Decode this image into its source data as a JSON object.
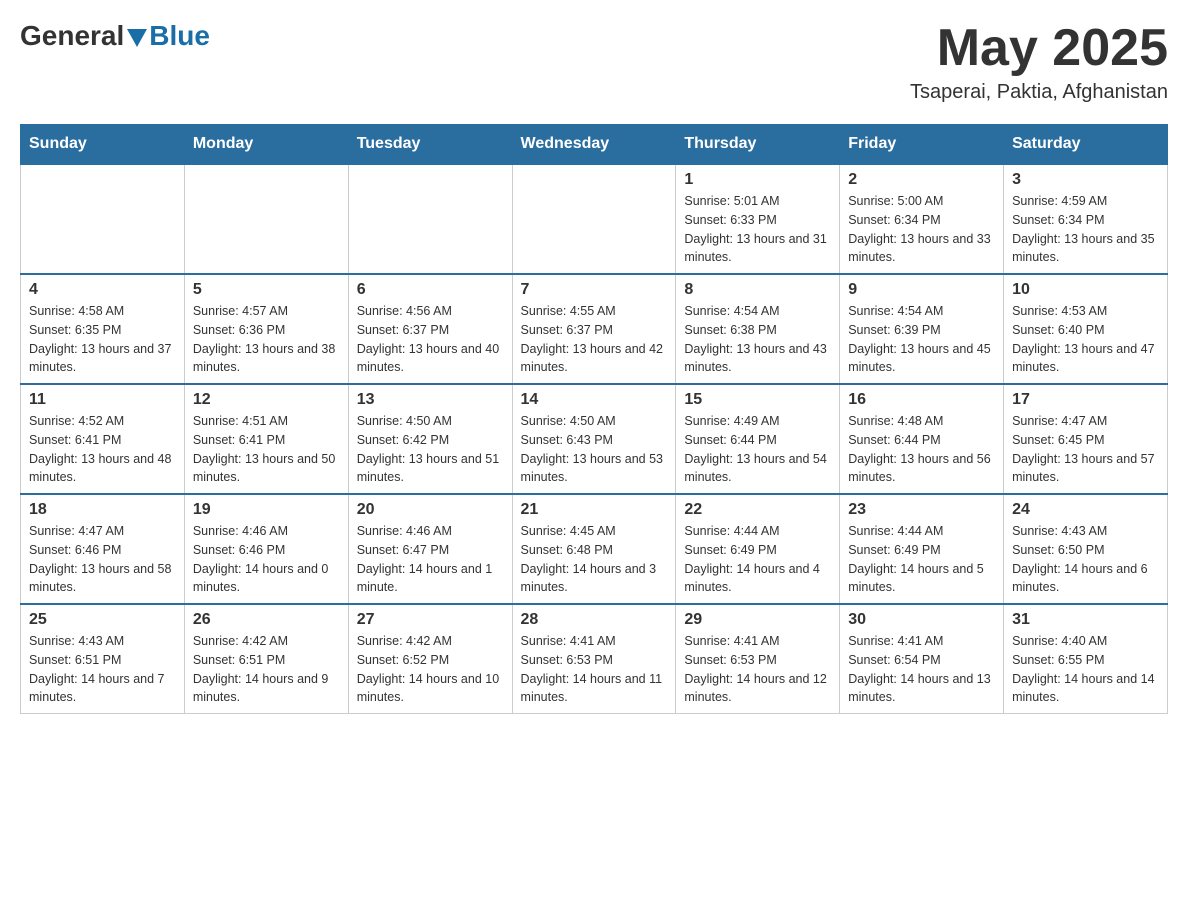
{
  "header": {
    "logo_general": "General",
    "logo_blue": "Blue",
    "month_year": "May 2025",
    "location": "Tsaperai, Paktia, Afghanistan"
  },
  "weekdays": [
    "Sunday",
    "Monday",
    "Tuesday",
    "Wednesday",
    "Thursday",
    "Friday",
    "Saturday"
  ],
  "weeks": [
    [
      {
        "day": "",
        "sunrise": "",
        "sunset": "",
        "daylight": ""
      },
      {
        "day": "",
        "sunrise": "",
        "sunset": "",
        "daylight": ""
      },
      {
        "day": "",
        "sunrise": "",
        "sunset": "",
        "daylight": ""
      },
      {
        "day": "",
        "sunrise": "",
        "sunset": "",
        "daylight": ""
      },
      {
        "day": "1",
        "sunrise": "Sunrise: 5:01 AM",
        "sunset": "Sunset: 6:33 PM",
        "daylight": "Daylight: 13 hours and 31 minutes."
      },
      {
        "day": "2",
        "sunrise": "Sunrise: 5:00 AM",
        "sunset": "Sunset: 6:34 PM",
        "daylight": "Daylight: 13 hours and 33 minutes."
      },
      {
        "day": "3",
        "sunrise": "Sunrise: 4:59 AM",
        "sunset": "Sunset: 6:34 PM",
        "daylight": "Daylight: 13 hours and 35 minutes."
      }
    ],
    [
      {
        "day": "4",
        "sunrise": "Sunrise: 4:58 AM",
        "sunset": "Sunset: 6:35 PM",
        "daylight": "Daylight: 13 hours and 37 minutes."
      },
      {
        "day": "5",
        "sunrise": "Sunrise: 4:57 AM",
        "sunset": "Sunset: 6:36 PM",
        "daylight": "Daylight: 13 hours and 38 minutes."
      },
      {
        "day": "6",
        "sunrise": "Sunrise: 4:56 AM",
        "sunset": "Sunset: 6:37 PM",
        "daylight": "Daylight: 13 hours and 40 minutes."
      },
      {
        "day": "7",
        "sunrise": "Sunrise: 4:55 AM",
        "sunset": "Sunset: 6:37 PM",
        "daylight": "Daylight: 13 hours and 42 minutes."
      },
      {
        "day": "8",
        "sunrise": "Sunrise: 4:54 AM",
        "sunset": "Sunset: 6:38 PM",
        "daylight": "Daylight: 13 hours and 43 minutes."
      },
      {
        "day": "9",
        "sunrise": "Sunrise: 4:54 AM",
        "sunset": "Sunset: 6:39 PM",
        "daylight": "Daylight: 13 hours and 45 minutes."
      },
      {
        "day": "10",
        "sunrise": "Sunrise: 4:53 AM",
        "sunset": "Sunset: 6:40 PM",
        "daylight": "Daylight: 13 hours and 47 minutes."
      }
    ],
    [
      {
        "day": "11",
        "sunrise": "Sunrise: 4:52 AM",
        "sunset": "Sunset: 6:41 PM",
        "daylight": "Daylight: 13 hours and 48 minutes."
      },
      {
        "day": "12",
        "sunrise": "Sunrise: 4:51 AM",
        "sunset": "Sunset: 6:41 PM",
        "daylight": "Daylight: 13 hours and 50 minutes."
      },
      {
        "day": "13",
        "sunrise": "Sunrise: 4:50 AM",
        "sunset": "Sunset: 6:42 PM",
        "daylight": "Daylight: 13 hours and 51 minutes."
      },
      {
        "day": "14",
        "sunrise": "Sunrise: 4:50 AM",
        "sunset": "Sunset: 6:43 PM",
        "daylight": "Daylight: 13 hours and 53 minutes."
      },
      {
        "day": "15",
        "sunrise": "Sunrise: 4:49 AM",
        "sunset": "Sunset: 6:44 PM",
        "daylight": "Daylight: 13 hours and 54 minutes."
      },
      {
        "day": "16",
        "sunrise": "Sunrise: 4:48 AM",
        "sunset": "Sunset: 6:44 PM",
        "daylight": "Daylight: 13 hours and 56 minutes."
      },
      {
        "day": "17",
        "sunrise": "Sunrise: 4:47 AM",
        "sunset": "Sunset: 6:45 PM",
        "daylight": "Daylight: 13 hours and 57 minutes."
      }
    ],
    [
      {
        "day": "18",
        "sunrise": "Sunrise: 4:47 AM",
        "sunset": "Sunset: 6:46 PM",
        "daylight": "Daylight: 13 hours and 58 minutes."
      },
      {
        "day": "19",
        "sunrise": "Sunrise: 4:46 AM",
        "sunset": "Sunset: 6:46 PM",
        "daylight": "Daylight: 14 hours and 0 minutes."
      },
      {
        "day": "20",
        "sunrise": "Sunrise: 4:46 AM",
        "sunset": "Sunset: 6:47 PM",
        "daylight": "Daylight: 14 hours and 1 minute."
      },
      {
        "day": "21",
        "sunrise": "Sunrise: 4:45 AM",
        "sunset": "Sunset: 6:48 PM",
        "daylight": "Daylight: 14 hours and 3 minutes."
      },
      {
        "day": "22",
        "sunrise": "Sunrise: 4:44 AM",
        "sunset": "Sunset: 6:49 PM",
        "daylight": "Daylight: 14 hours and 4 minutes."
      },
      {
        "day": "23",
        "sunrise": "Sunrise: 4:44 AM",
        "sunset": "Sunset: 6:49 PM",
        "daylight": "Daylight: 14 hours and 5 minutes."
      },
      {
        "day": "24",
        "sunrise": "Sunrise: 4:43 AM",
        "sunset": "Sunset: 6:50 PM",
        "daylight": "Daylight: 14 hours and 6 minutes."
      }
    ],
    [
      {
        "day": "25",
        "sunrise": "Sunrise: 4:43 AM",
        "sunset": "Sunset: 6:51 PM",
        "daylight": "Daylight: 14 hours and 7 minutes."
      },
      {
        "day": "26",
        "sunrise": "Sunrise: 4:42 AM",
        "sunset": "Sunset: 6:51 PM",
        "daylight": "Daylight: 14 hours and 9 minutes."
      },
      {
        "day": "27",
        "sunrise": "Sunrise: 4:42 AM",
        "sunset": "Sunset: 6:52 PM",
        "daylight": "Daylight: 14 hours and 10 minutes."
      },
      {
        "day": "28",
        "sunrise": "Sunrise: 4:41 AM",
        "sunset": "Sunset: 6:53 PM",
        "daylight": "Daylight: 14 hours and 11 minutes."
      },
      {
        "day": "29",
        "sunrise": "Sunrise: 4:41 AM",
        "sunset": "Sunset: 6:53 PM",
        "daylight": "Daylight: 14 hours and 12 minutes."
      },
      {
        "day": "30",
        "sunrise": "Sunrise: 4:41 AM",
        "sunset": "Sunset: 6:54 PM",
        "daylight": "Daylight: 14 hours and 13 minutes."
      },
      {
        "day": "31",
        "sunrise": "Sunrise: 4:40 AM",
        "sunset": "Sunset: 6:55 PM",
        "daylight": "Daylight: 14 hours and 14 minutes."
      }
    ]
  ]
}
